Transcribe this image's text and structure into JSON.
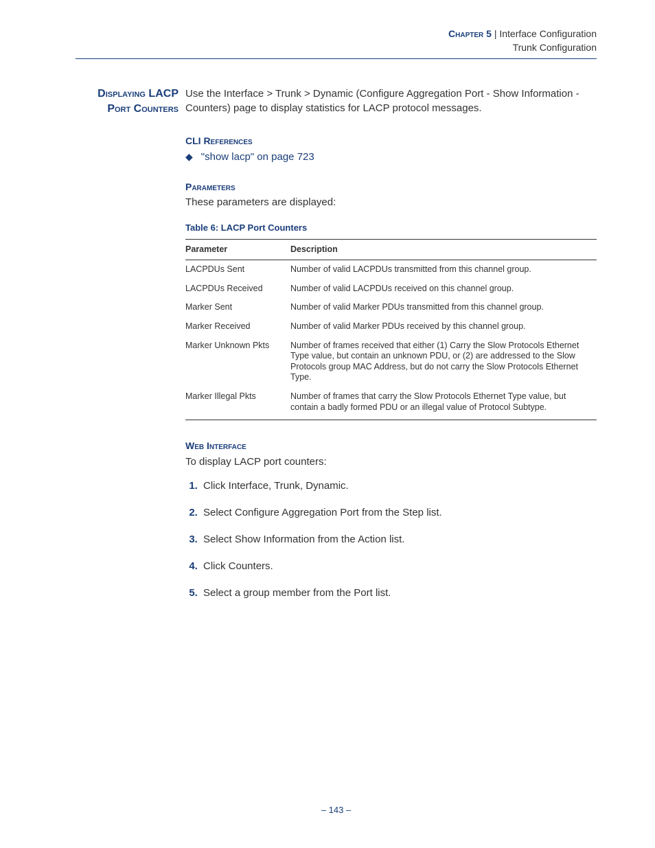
{
  "header": {
    "chapter": "Chapter 5",
    "sep": "  |  ",
    "chapter_title": "Interface Configuration",
    "section_title": "Trunk Configuration"
  },
  "side_heading_line1": "Displaying LACP",
  "side_heading_line2": "Port Counters",
  "intro": "Use the Interface > Trunk > Dynamic (Configure Aggregation Port - Show Information - Counters) page to display statistics for LACP protocol messages.",
  "cli_refs": {
    "heading": "CLI References",
    "bullet": "◆",
    "link_text": "\"show lacp\" on page 723"
  },
  "params": {
    "heading": "Parameters",
    "intro": "These parameters are displayed:",
    "table_caption": "Table 6: LACP Port Counters",
    "col1": "Parameter",
    "col2": "Description",
    "rows": [
      {
        "p": "LACPDUs Sent",
        "d": "Number of valid LACPDUs transmitted from this channel group."
      },
      {
        "p": "LACPDUs Received",
        "d": "Number of valid LACPDUs received on this channel group."
      },
      {
        "p": "Marker Sent",
        "d": "Number of valid Marker PDUs transmitted from this channel group."
      },
      {
        "p": "Marker Received",
        "d": "Number of valid Marker PDUs received by this channel group."
      },
      {
        "p": "Marker Unknown Pkts",
        "d": "Number of frames received that either (1) Carry the Slow Protocols Ethernet Type value, but contain an unknown PDU, or (2) are addressed to the Slow Protocols group MAC Address, but do not carry the Slow Protocols Ethernet Type."
      },
      {
        "p": "Marker Illegal Pkts",
        "d": "Number of frames that carry the Slow Protocols Ethernet Type value, but contain a badly formed PDU or an illegal value of Protocol Subtype."
      }
    ]
  },
  "web": {
    "heading": "Web Interface",
    "intro": "To display LACP port counters:",
    "steps": [
      "Click Interface, Trunk, Dynamic.",
      "Select Configure Aggregation Port from the Step list.",
      "Select Show Information from the Action list.",
      "Click Counters.",
      "Select a group member from the Port list."
    ]
  },
  "footer": "–  143  –"
}
